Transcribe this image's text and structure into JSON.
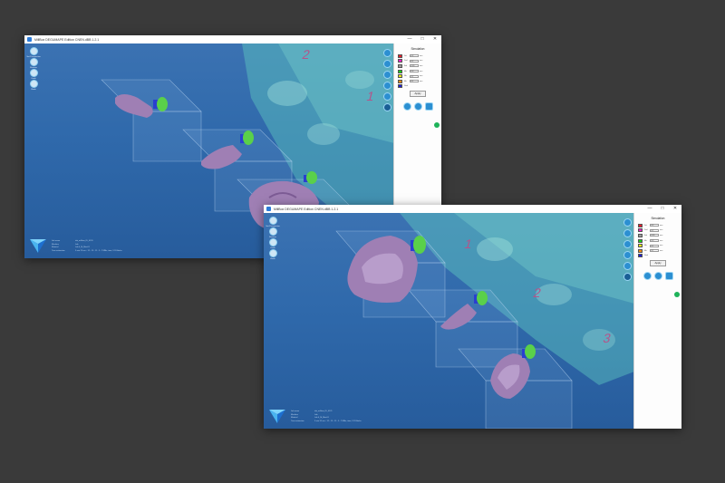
{
  "window1": {
    "title": "MillBox DEGUMAPE Edition CNEN.dBB 1.2.1",
    "tools": [
      {
        "label": "Set Perspective",
        "icon": "compass-icon"
      },
      {
        "label": "Restore",
        "icon": "layers-icon"
      },
      {
        "label": "Undo",
        "icon": "undo-icon"
      },
      {
        "label": "Redo",
        "icon": "redo-icon"
      }
    ],
    "info": [
      [
        "Job name",
        "tab_millbox_ID_4120"
      ],
      [
        "Machine",
        "Lab"
      ],
      [
        "Material",
        "Lab 4_M_Misc01"
      ],
      [
        "Time estimation",
        "5 min 23 sec - 12 - 15 - 11 - 5 - 7 MMs, time, 121 Blocks"
      ]
    ],
    "panel_title": "Simulation",
    "apply_label": "Apply",
    "sim_rows": [
      {
        "color": "#e81e2b",
        "label": "1st",
        "value": "0.3",
        "unit": "mm"
      },
      {
        "color": "#e91ec8",
        "label": "2nd",
        "value": "0.2",
        "unit": "mm"
      },
      {
        "color": "#9a9a9a",
        "label": "3rd",
        "value": "0.05",
        "unit": "mm"
      },
      {
        "color": "#19d219",
        "label": "4th",
        "value": "0.0",
        "unit": "mm"
      },
      {
        "color": "#e8e615",
        "label": "5th",
        "value": "0.1",
        "unit": "mm"
      },
      {
        "color": "#f08c14",
        "label": "6th",
        "value": "0.1",
        "unit": "mm"
      },
      {
        "color": "#1f1fd6",
        "label": "Disk",
        "value": "",
        "unit": ""
      }
    ],
    "markers": [
      "2",
      "1"
    ]
  },
  "window2": {
    "title": "MillBox DEGUMAPE Edition CNEN.dBB 1.2.1",
    "tools": [
      {
        "label": "Set Perspective",
        "icon": "compass-icon"
      },
      {
        "label": "Restore",
        "icon": "layers-icon"
      },
      {
        "label": "Undo",
        "icon": "undo-icon"
      },
      {
        "label": "Redo",
        "icon": "redo-icon"
      }
    ],
    "info": [
      [
        "Job name",
        "tab_millbox_ID_4121"
      ],
      [
        "Machine",
        "Lab"
      ],
      [
        "Material",
        "Lab 4_M_Misc01"
      ],
      [
        "Time estimation",
        "5 min 31 sec - 12 - 15 - 11 - 5 - 7 MMs, time, 121 Blocks"
      ]
    ],
    "panel_title": "Simulation",
    "apply_label": "Apply",
    "sim_rows": [
      {
        "color": "#e81e2b",
        "label": "1st",
        "value": "0.3",
        "unit": "mm"
      },
      {
        "color": "#e91ec8",
        "label": "2nd",
        "value": "0.2",
        "unit": "mm"
      },
      {
        "color": "#9a9a9a",
        "label": "3rd",
        "value": "0.05",
        "unit": "mm"
      },
      {
        "color": "#19d219",
        "label": "4th",
        "value": "0.0",
        "unit": "mm"
      },
      {
        "color": "#e8e615",
        "label": "5th",
        "value": "0.1",
        "unit": "mm"
      },
      {
        "color": "#f08c14",
        "label": "6th",
        "value": "0.1",
        "unit": "mm"
      },
      {
        "color": "#1f1fd6",
        "label": "Disk",
        "value": "",
        "unit": ""
      }
    ],
    "markers": [
      "1",
      "2",
      "3"
    ]
  },
  "colors": {
    "background": "#3a3a3a",
    "viewport_blue": "#2f69ab",
    "teal_machine": "#5fc9c0",
    "crown_purple": "#9f7fb4",
    "connector_green": "#5ad04a",
    "button_blue": "#2c8fd1"
  }
}
